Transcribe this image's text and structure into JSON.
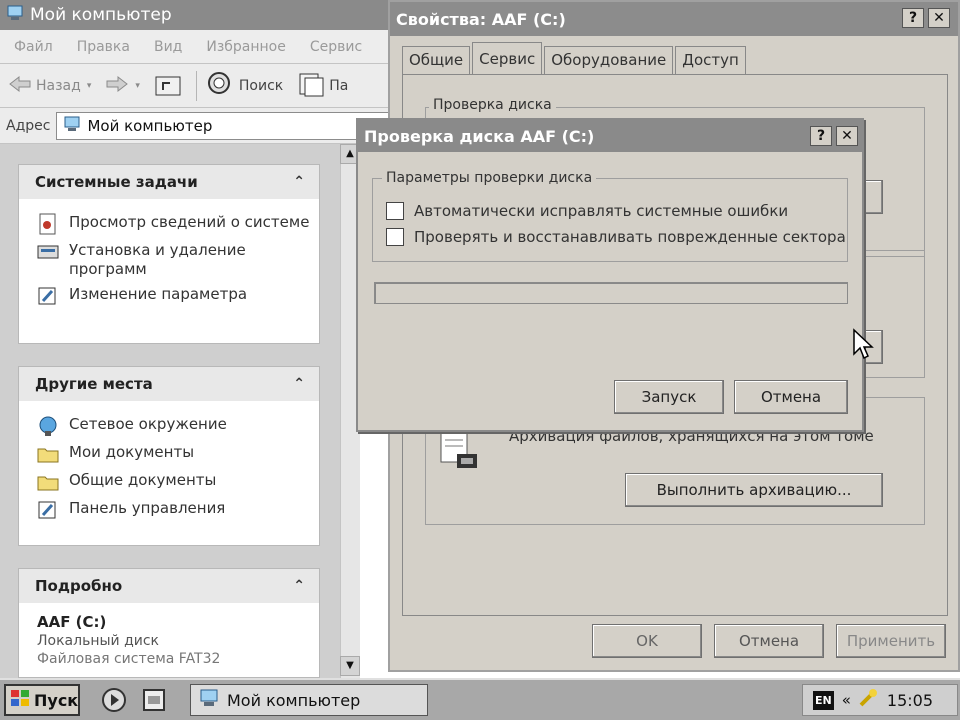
{
  "my_computer": {
    "title": "Мой компьютер",
    "menu": [
      "Файл",
      "Правка",
      "Вид",
      "Избранное",
      "Сервис"
    ],
    "toolbar": {
      "back": "Назад",
      "search": "Поиск",
      "folders": "Па"
    },
    "address_label": "Адрес",
    "address_value": "Мой компьютер",
    "system_tasks": {
      "title": "Системные задачи",
      "items": [
        "Просмотр сведений о системе",
        "Установка и удаление программ",
        "Изменение параметра"
      ]
    },
    "other_places": {
      "title": "Другие места",
      "items": [
        "Сетевое окружение",
        "Мои документы",
        "Общие документы",
        "Панель управления"
      ]
    },
    "details": {
      "title": "Подробно",
      "name": "AAF (C:)",
      "type": "Локальный диск",
      "filesystem": "Файловая система FAT32"
    }
  },
  "properties": {
    "title": "Свойства: AAF (C:)",
    "tabs": [
      "Общие",
      "Сервис",
      "Оборудование",
      "Доступ"
    ],
    "active_tab": "Сервис",
    "group_check": "Проверка диска",
    "archive_text": "Архивация файлов, хранящихся на этом томе",
    "archive_button": "Выполнить архивацию...",
    "ok": "OK",
    "cancel": "Отмена",
    "apply": "Применить"
  },
  "check_dialog": {
    "title": "Проверка диска AAF (C:)",
    "group": "Параметры проверки диска",
    "option1": "Автоматически исправлять системные ошибки",
    "option2": "Проверять и восстанавливать поврежденные сектора",
    "start": "Запуск",
    "cancel": "Отмена"
  },
  "taskbar": {
    "start": "Пуск",
    "task": "Мой компьютер",
    "lang": "EN",
    "chevron": "«",
    "clock": "15:05"
  },
  "title_buttons": {
    "help": "?",
    "close": "✕"
  },
  "icons": [
    "computer-icon",
    "back-arrow-icon",
    "forward-arrow-icon",
    "up-folder-icon",
    "search-icon",
    "folders-icon",
    "info-icon",
    "programs-icon",
    "control-icon",
    "network-icon",
    "folder-icon",
    "archive-icon",
    "windows-flag-icon",
    "media-player-icon",
    "desktop-icon",
    "tray-icon"
  ],
  "colors": {
    "title_inactive": "#8a8a8a",
    "dialog_face": "#d4d0c8",
    "panel_gray": "#cfcfcf"
  }
}
